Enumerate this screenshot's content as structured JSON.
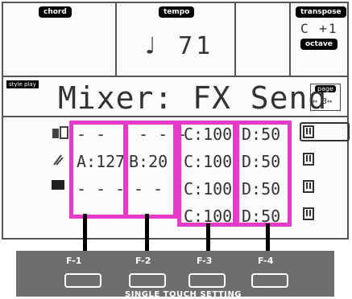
{
  "header": {
    "chord_label": "chord",
    "tempo_label": "tempo",
    "tempo_value": "♩ 71",
    "transpose_label": "transpose",
    "transpose_value": "C +1",
    "octave_label": "octave"
  },
  "title": {
    "style_play": "style play",
    "text": "Mixer: FX Send",
    "page_label": "page",
    "page_value": "⇔ 3⇔"
  },
  "rows": [
    {
      "a": "- -",
      "b": "- - -",
      "c": "C:100",
      "d": "D:50"
    },
    {
      "a": "A:127",
      "b": "B:20",
      "c": "C:100",
      "d": "D:50"
    },
    {
      "a": "- - -",
      "b": "- - -",
      "c": "C:100",
      "d": "D:50"
    },
    {
      "a": "",
      "b": "",
      "c": "C:100",
      "d": "D:50"
    }
  ],
  "buttons": {
    "f1": "F-1",
    "f2": "F-2",
    "f3": "F-3",
    "f4": "F-4",
    "caption": "SINGLE TOUCH SETTING"
  },
  "colors": {
    "highlight": "#e83ac8",
    "panel": "#6e6e6e"
  }
}
